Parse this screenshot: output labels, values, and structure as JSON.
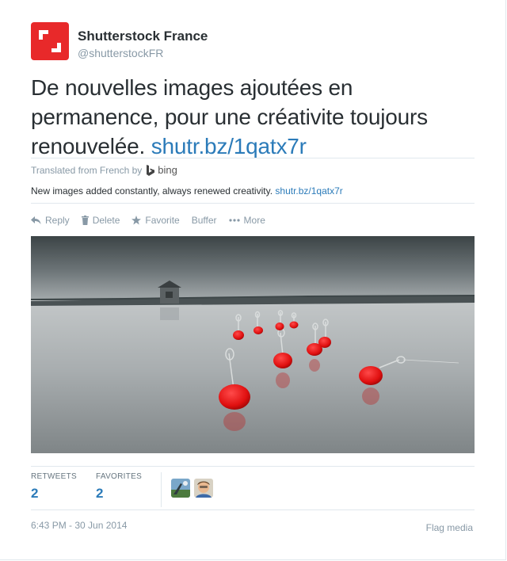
{
  "account": {
    "fullname": "Shutterstock France",
    "screenname": "@shutterstockFR",
    "brand_color": "#e8292a",
    "avatar_icon": "shutterstock-logo-icon"
  },
  "tweet": {
    "text": "De nouvelles images ajoutées en permanence, pour une créativite toujours renouvelée.",
    "link": "shutr.bz/1qatx7r",
    "link_color": "#2b7bb9"
  },
  "translation": {
    "label": "Translated from French by",
    "provider": "bing",
    "provider_icon": "bing-logo-icon",
    "text": "New images added constantly, always renewed creativity.",
    "link": "shutr.bz/1qatx7r"
  },
  "actions": [
    {
      "label": "Reply",
      "icon": "reply-icon"
    },
    {
      "label": "Delete",
      "icon": "trash-icon"
    },
    {
      "label": "Favorite",
      "icon": "star-icon"
    },
    {
      "label": "Buffer",
      "icon": ""
    },
    {
      "label": "More",
      "icon": "more-dots-icon"
    }
  ],
  "stats": {
    "retweets_label": "RETWEETS",
    "retweets_count": "2",
    "favorites_label": "FAVORITES",
    "favorites_count": "2"
  },
  "footer": {
    "timestamp": "6:43 PM - 30 Jun 2014",
    "flag_label": "Flag media"
  }
}
